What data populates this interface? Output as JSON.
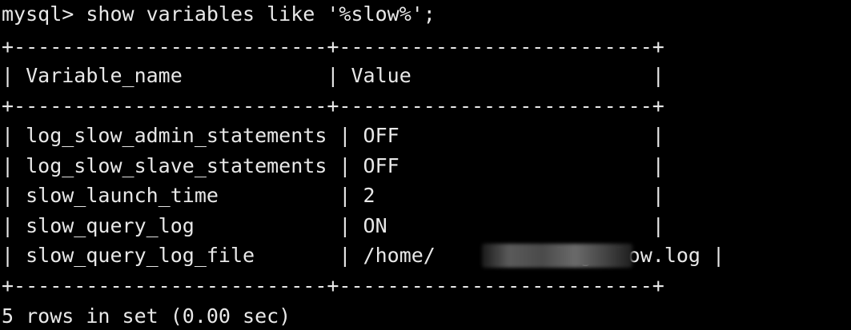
{
  "terminal": {
    "prompt_line": "mysql> show variables like '%slow%';",
    "border_line": "+--------------------------+--------------------------+",
    "header_line": "| Variable_name            | Value                    |",
    "rows": [
      "| log_slow_admin_statements | OFF                     |",
      "| log_slow_slave_statements | OFF                     |",
      "| slow_launch_time          | 2                       |",
      "| slow_query_log            | ON                      |",
      "| slow_query_log_file       | /home/         /log/slow.log |"
    ],
    "footer_line": "5 rows in set (0.00 sec)",
    "background_color": "#000000",
    "text_color": "#e8e8e8"
  }
}
